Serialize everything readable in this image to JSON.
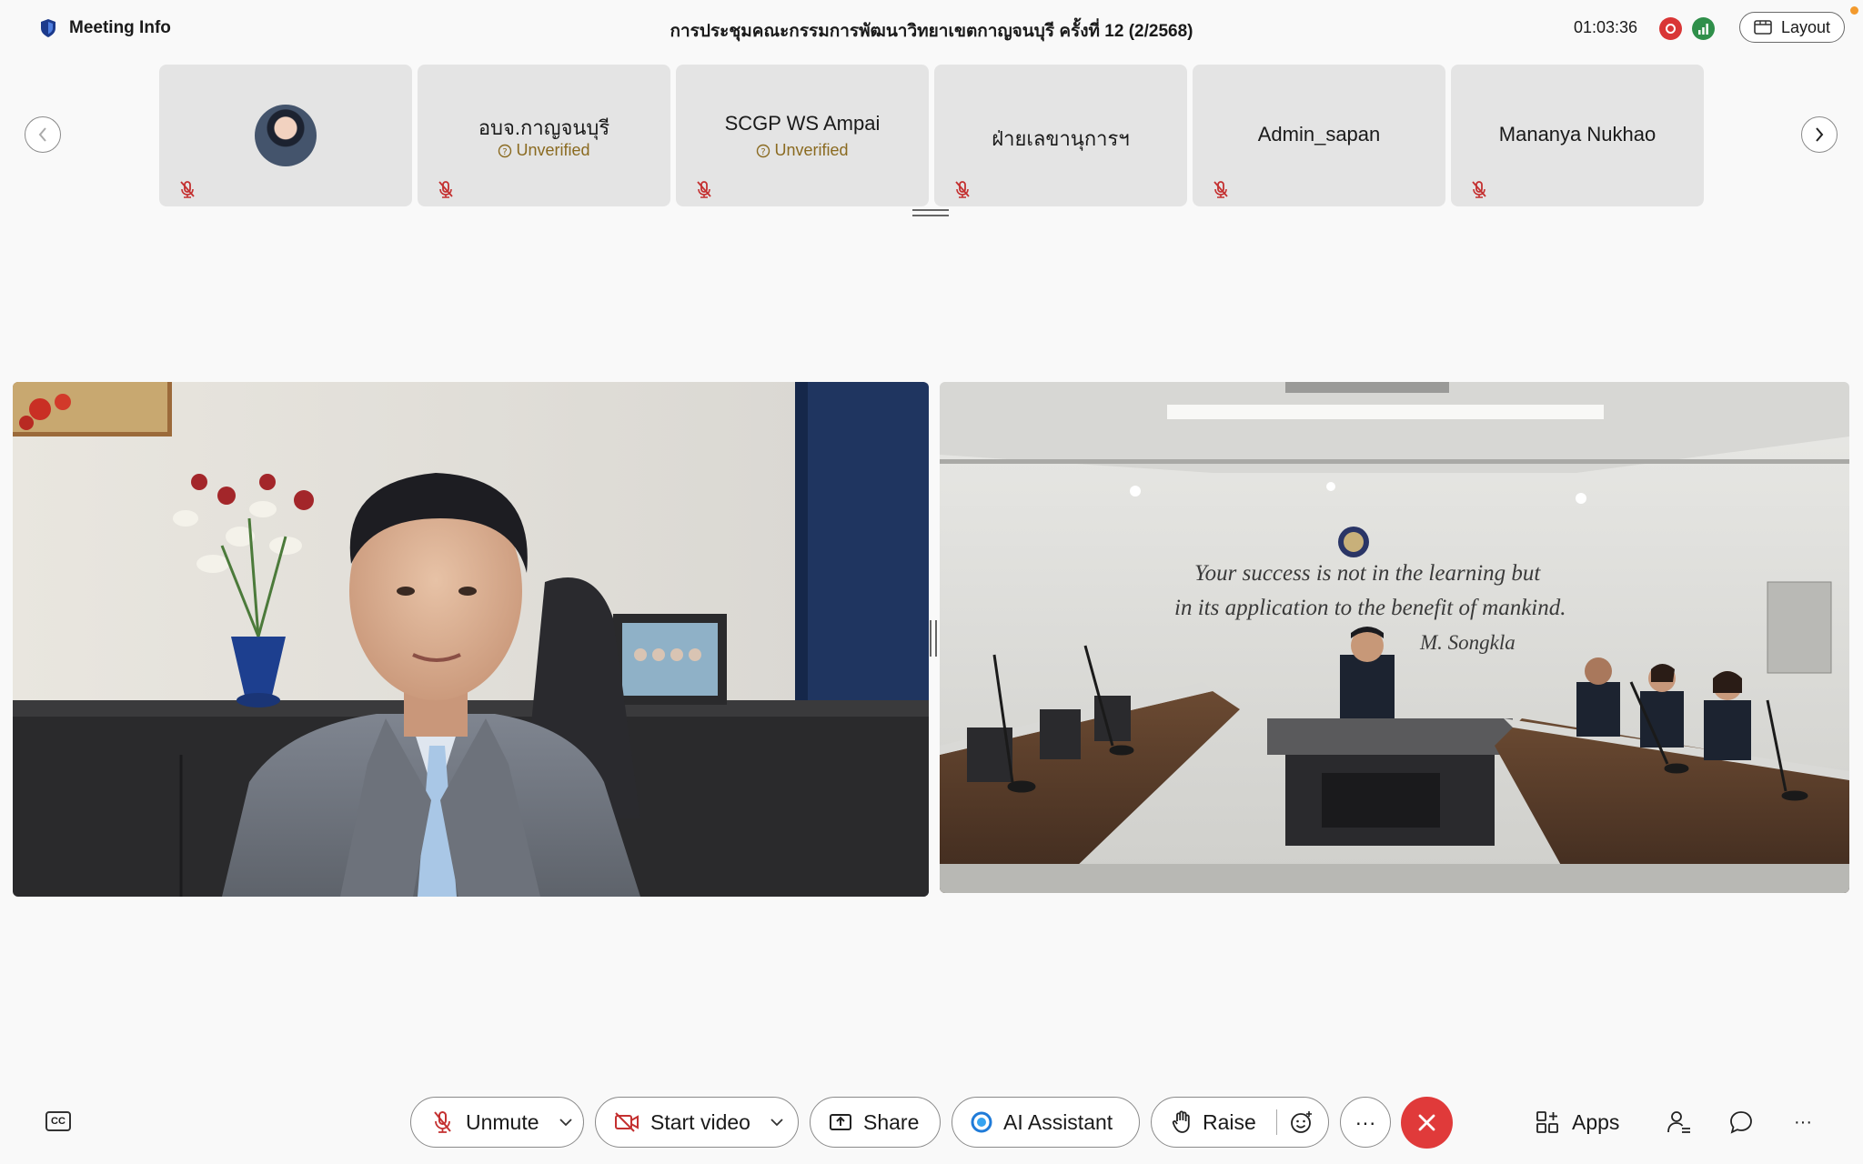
{
  "header": {
    "meeting_info_label": "Meeting Info",
    "title": "การประชุมคณะกรรมการพัฒนาวิทยาเขตกาญจนบุรี ครั้งที่ 12 (2/2568)",
    "timer": "01:03:36",
    "layout_label": "Layout"
  },
  "participants": [
    {
      "name": "",
      "verification": "",
      "has_avatar": true,
      "muted": true
    },
    {
      "name": "อบจ.กาญจนบุรี",
      "verification": "Unverified",
      "muted": true
    },
    {
      "name": "SCGP WS Ampai",
      "verification": "Unverified",
      "muted": true
    },
    {
      "name": "ฝ่ายเลขานุการฯ",
      "verification": "",
      "muted": true
    },
    {
      "name": "Admin_sapan",
      "verification": "",
      "muted": true
    },
    {
      "name": "Mananya Nukhao",
      "verification": "",
      "muted": true
    }
  ],
  "conference_room": {
    "wall_text_line1": "Your success is not in the learning but",
    "wall_text_line2": "in its application to the benefit of mankind.",
    "wall_text_signature": "M. Songkla"
  },
  "toolbar": {
    "unmute_label": "Unmute",
    "start_video_label": "Start video",
    "share_label": "Share",
    "ai_assistant_label": "AI Assistant",
    "raise_label": "Raise",
    "more_label": "···",
    "apps_label": "Apps",
    "overflow_label": "···",
    "cc_label": "CC"
  },
  "colors": {
    "end_call": "#e03a3a",
    "recording": "#d93636",
    "network": "#2f8f4a",
    "unverified_text": "#8a6a20",
    "ai_accent": "#1f7bd8"
  }
}
